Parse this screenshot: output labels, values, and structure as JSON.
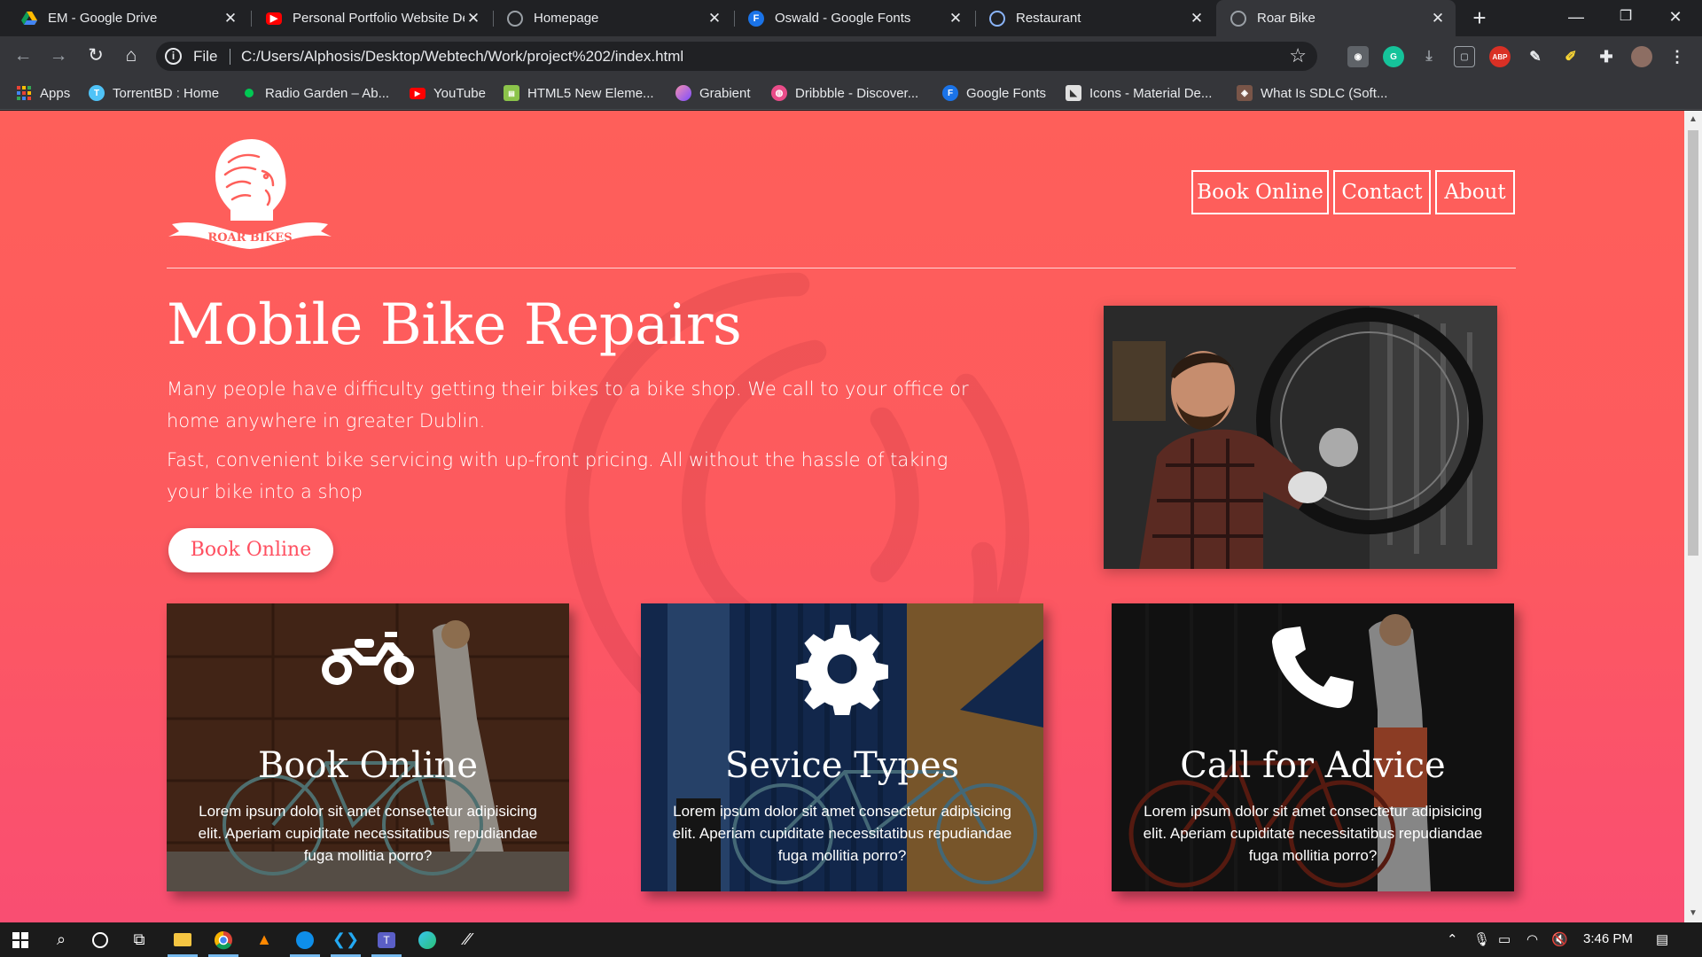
{
  "browser": {
    "tabs": [
      {
        "title": "EM - Google Drive",
        "icon": "drive-icon",
        "color": "#f4b400"
      },
      {
        "title": "Personal Portfolio Website De",
        "icon": "youtube-icon",
        "color": "#ff0000"
      },
      {
        "title": "Homepage",
        "icon": "globe-icon",
        "color": "#9aa0a6"
      },
      {
        "title": "Oswald - Google Fonts",
        "icon": "google-fonts-icon",
        "color": "#1a73e8",
        "glyph": "F"
      },
      {
        "title": "Restaurant",
        "icon": "spiral-icon",
        "color": "#8ab4f8"
      },
      {
        "title": "Roar Bike",
        "icon": "globe-icon",
        "color": "#9aa0a6"
      }
    ],
    "address": {
      "scheme": "File",
      "url": "C:/Users/Alphosis/Desktop/Webtech/Work/project%202/index.html"
    },
    "bookmarks": [
      {
        "label": "Apps",
        "icon": "apps-grid-icon",
        "color": "#ea4335"
      },
      {
        "label": "TorrentBD : Home",
        "icon": "torrentbd-icon",
        "color": "#4fc3f7"
      },
      {
        "label": "Radio Garden – Ab...",
        "icon": "radio-garden-icon",
        "color": "#00c853"
      },
      {
        "label": "YouTube",
        "icon": "youtube-icon",
        "color": "#ff0000"
      },
      {
        "label": "HTML5 New Eleme...",
        "icon": "html5-icon",
        "color": "#8bc34a"
      },
      {
        "label": "Grabient",
        "icon": "grabient-icon",
        "color": "#b388ff"
      },
      {
        "label": "Dribbble - Discover...",
        "icon": "dribbble-icon",
        "color": "#ea4c89"
      },
      {
        "label": "Google Fonts",
        "icon": "google-fonts-icon",
        "color": "#1a73e8",
        "glyph": "F"
      },
      {
        "label": "Icons - Material De...",
        "icon": "material-icon",
        "color": "#e0e0e0"
      },
      {
        "label": "What Is SDLC (Soft...",
        "icon": "sdlc-icon",
        "color": "#795548"
      }
    ]
  },
  "page": {
    "logo_text": "ROAR BIKES",
    "nav": [
      {
        "label": "Book Online"
      },
      {
        "label": "Contact"
      },
      {
        "label": "About"
      }
    ],
    "hero": {
      "title": "Mobile Bike Repairs",
      "paragraph_1": "Many people have difficulty getting their bikes to a bike shop. We call to your office or home anywhere in greater Dublin.",
      "paragraph_2": "Fast, convenient bike servicing with up-front pricing. All without the hassle of taking your bike into a shop",
      "button": "Book Online"
    },
    "cards": [
      {
        "title": "Book Online",
        "icon": "motorcycle-icon",
        "text": "Lorem ipsum dolor sit amet consectetur adipisicing elit. Aperiam cupiditate necessitatibus repudiandae fuga mollitia porro?"
      },
      {
        "title": "Sevice Types",
        "icon": "gear-icon",
        "text": "Lorem ipsum dolor sit amet consectetur adipisicing elit. Aperiam cupiditate necessitatibus repudiandae fuga mollitia porro?"
      },
      {
        "title": "Call for Advice",
        "icon": "phone-icon",
        "text": "Lorem ipsum dolor sit amet consectetur adipisicing elit. Aperiam cupiditate necessitatibus repudiandae fuga mollitia porro?"
      }
    ],
    "colors": {
      "gradient_top": "#fe5f5a",
      "gradient_bottom": "#f94e72",
      "accent": "#ff5061"
    }
  },
  "taskbar": {
    "clock": "3:46 PM"
  }
}
